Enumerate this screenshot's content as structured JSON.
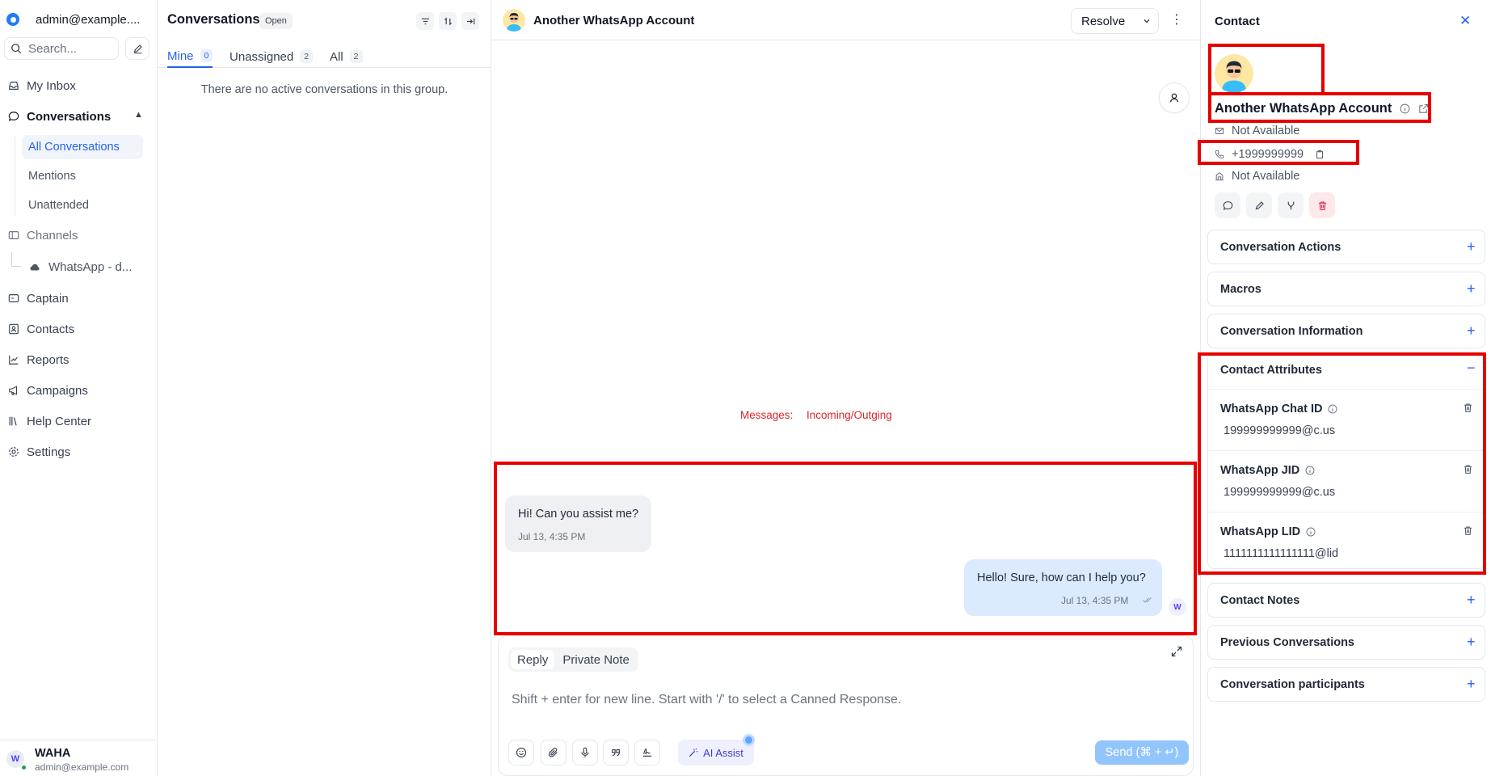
{
  "sidebar": {
    "account": "admin@example....",
    "search_placeholder": "Search...",
    "nav": {
      "my_inbox": "My Inbox",
      "conversations": "Conversations",
      "all_conversations": "All Conversations",
      "mentions": "Mentions",
      "unattended": "Unattended",
      "channels": "Channels",
      "whatsapp_channel": "WhatsApp - d...",
      "captain": "Captain",
      "contacts": "Contacts",
      "reports": "Reports",
      "campaigns": "Campaigns",
      "help_center": "Help Center",
      "settings": "Settings"
    },
    "user": {
      "initial": "W",
      "name": "WAHA",
      "email": "admin@example.com"
    }
  },
  "conversation_list": {
    "title": "Conversations",
    "status_badge": "Open",
    "tabs": [
      {
        "label": "Mine",
        "count": "0"
      },
      {
        "label": "Unassigned",
        "count": "2"
      },
      {
        "label": "All",
        "count": "2"
      }
    ],
    "empty_text": "There are no active conversations in this group."
  },
  "chat": {
    "contact_name": "Another WhatsApp Account",
    "resolve_label": "Resolve",
    "annotation": {
      "label": "Messages:",
      "value": "Incoming/Outging"
    },
    "messages": [
      {
        "direction": "incoming",
        "text": "Hi! Can you assist me?",
        "time": "Jul 13, 4:35 PM"
      },
      {
        "direction": "outgoing",
        "text": "Hello! Sure, how can I help you?",
        "time": "Jul 13, 4:35 PM",
        "avatar": "W"
      }
    ],
    "composer": {
      "tabs": [
        "Reply",
        "Private Note"
      ],
      "placeholder": "Shift + enter for new line. Start with '/' to select a Canned Response.",
      "ai_assist_label": "AI Assist",
      "send_label": "Send (⌘ + ↵)"
    }
  },
  "contact_panel": {
    "title": "Contact",
    "name": "Another WhatsApp Account",
    "email": "Not Available",
    "phone": "+1999999999",
    "company": "Not Available",
    "sections": {
      "conversation_actions": "Conversation Actions",
      "macros": "Macros",
      "conversation_information": "Conversation Information",
      "contact_attributes": "Contact Attributes",
      "contact_notes": "Contact Notes",
      "previous_conversations": "Previous Conversations",
      "conversation_participants": "Conversation participants"
    },
    "attributes": [
      {
        "label": "WhatsApp Chat ID",
        "value": "199999999999@c.us"
      },
      {
        "label": "WhatsApp JID",
        "value": "199999999999@c.us"
      },
      {
        "label": "WhatsApp LID",
        "value": "1111111111111111@lid"
      }
    ]
  },
  "colors": {
    "accent": "#2563eb",
    "annotation": "#e60000",
    "outgoing_bubble": "#dbeafe",
    "incoming_bubble": "#eef0f3"
  }
}
